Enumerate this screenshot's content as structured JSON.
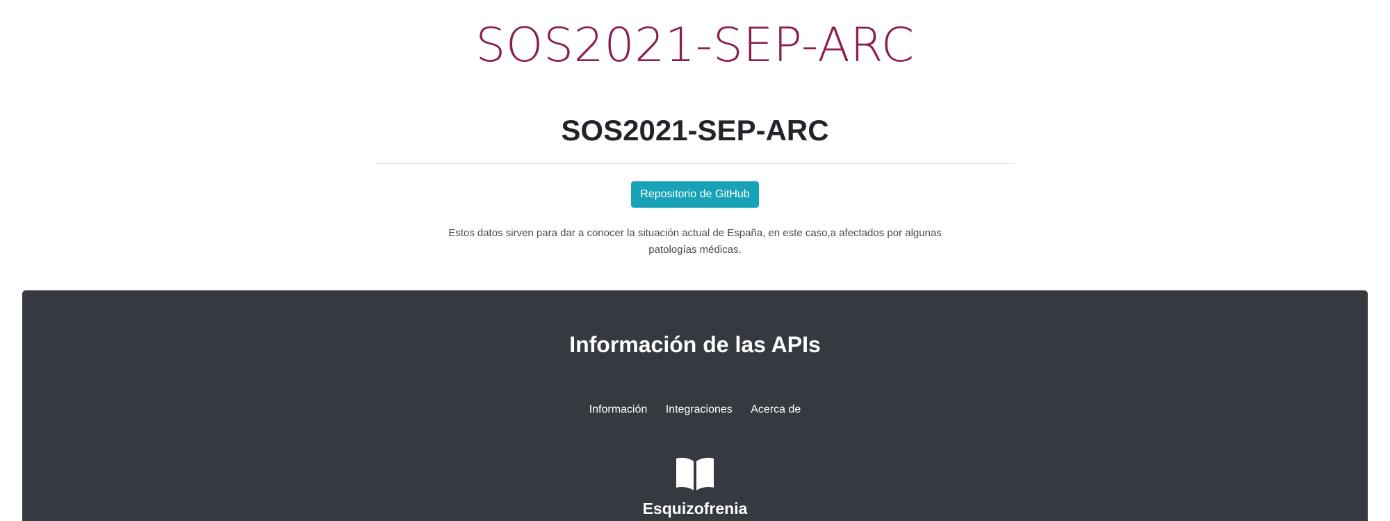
{
  "header": {
    "site_title": "SOS2021-SEP-ARC"
  },
  "hero": {
    "heading": "SOS2021-SEP-ARC",
    "github_button_label": "Repositorio de GitHub",
    "description": "Estos datos sirven para dar a conocer la situación actual de España, en este caso,a afectados por algunas patologías médicas."
  },
  "api_section": {
    "heading": "Información de las APIs",
    "nav": [
      {
        "label": "Información"
      },
      {
        "label": "Integraciones"
      },
      {
        "label": "Acerca de"
      }
    ],
    "card": {
      "icon": "book-icon",
      "title": "Esquizofrenia"
    }
  },
  "colors": {
    "title": "#8a1f4f",
    "button": "#17a2b8",
    "panel": "#343a40"
  }
}
